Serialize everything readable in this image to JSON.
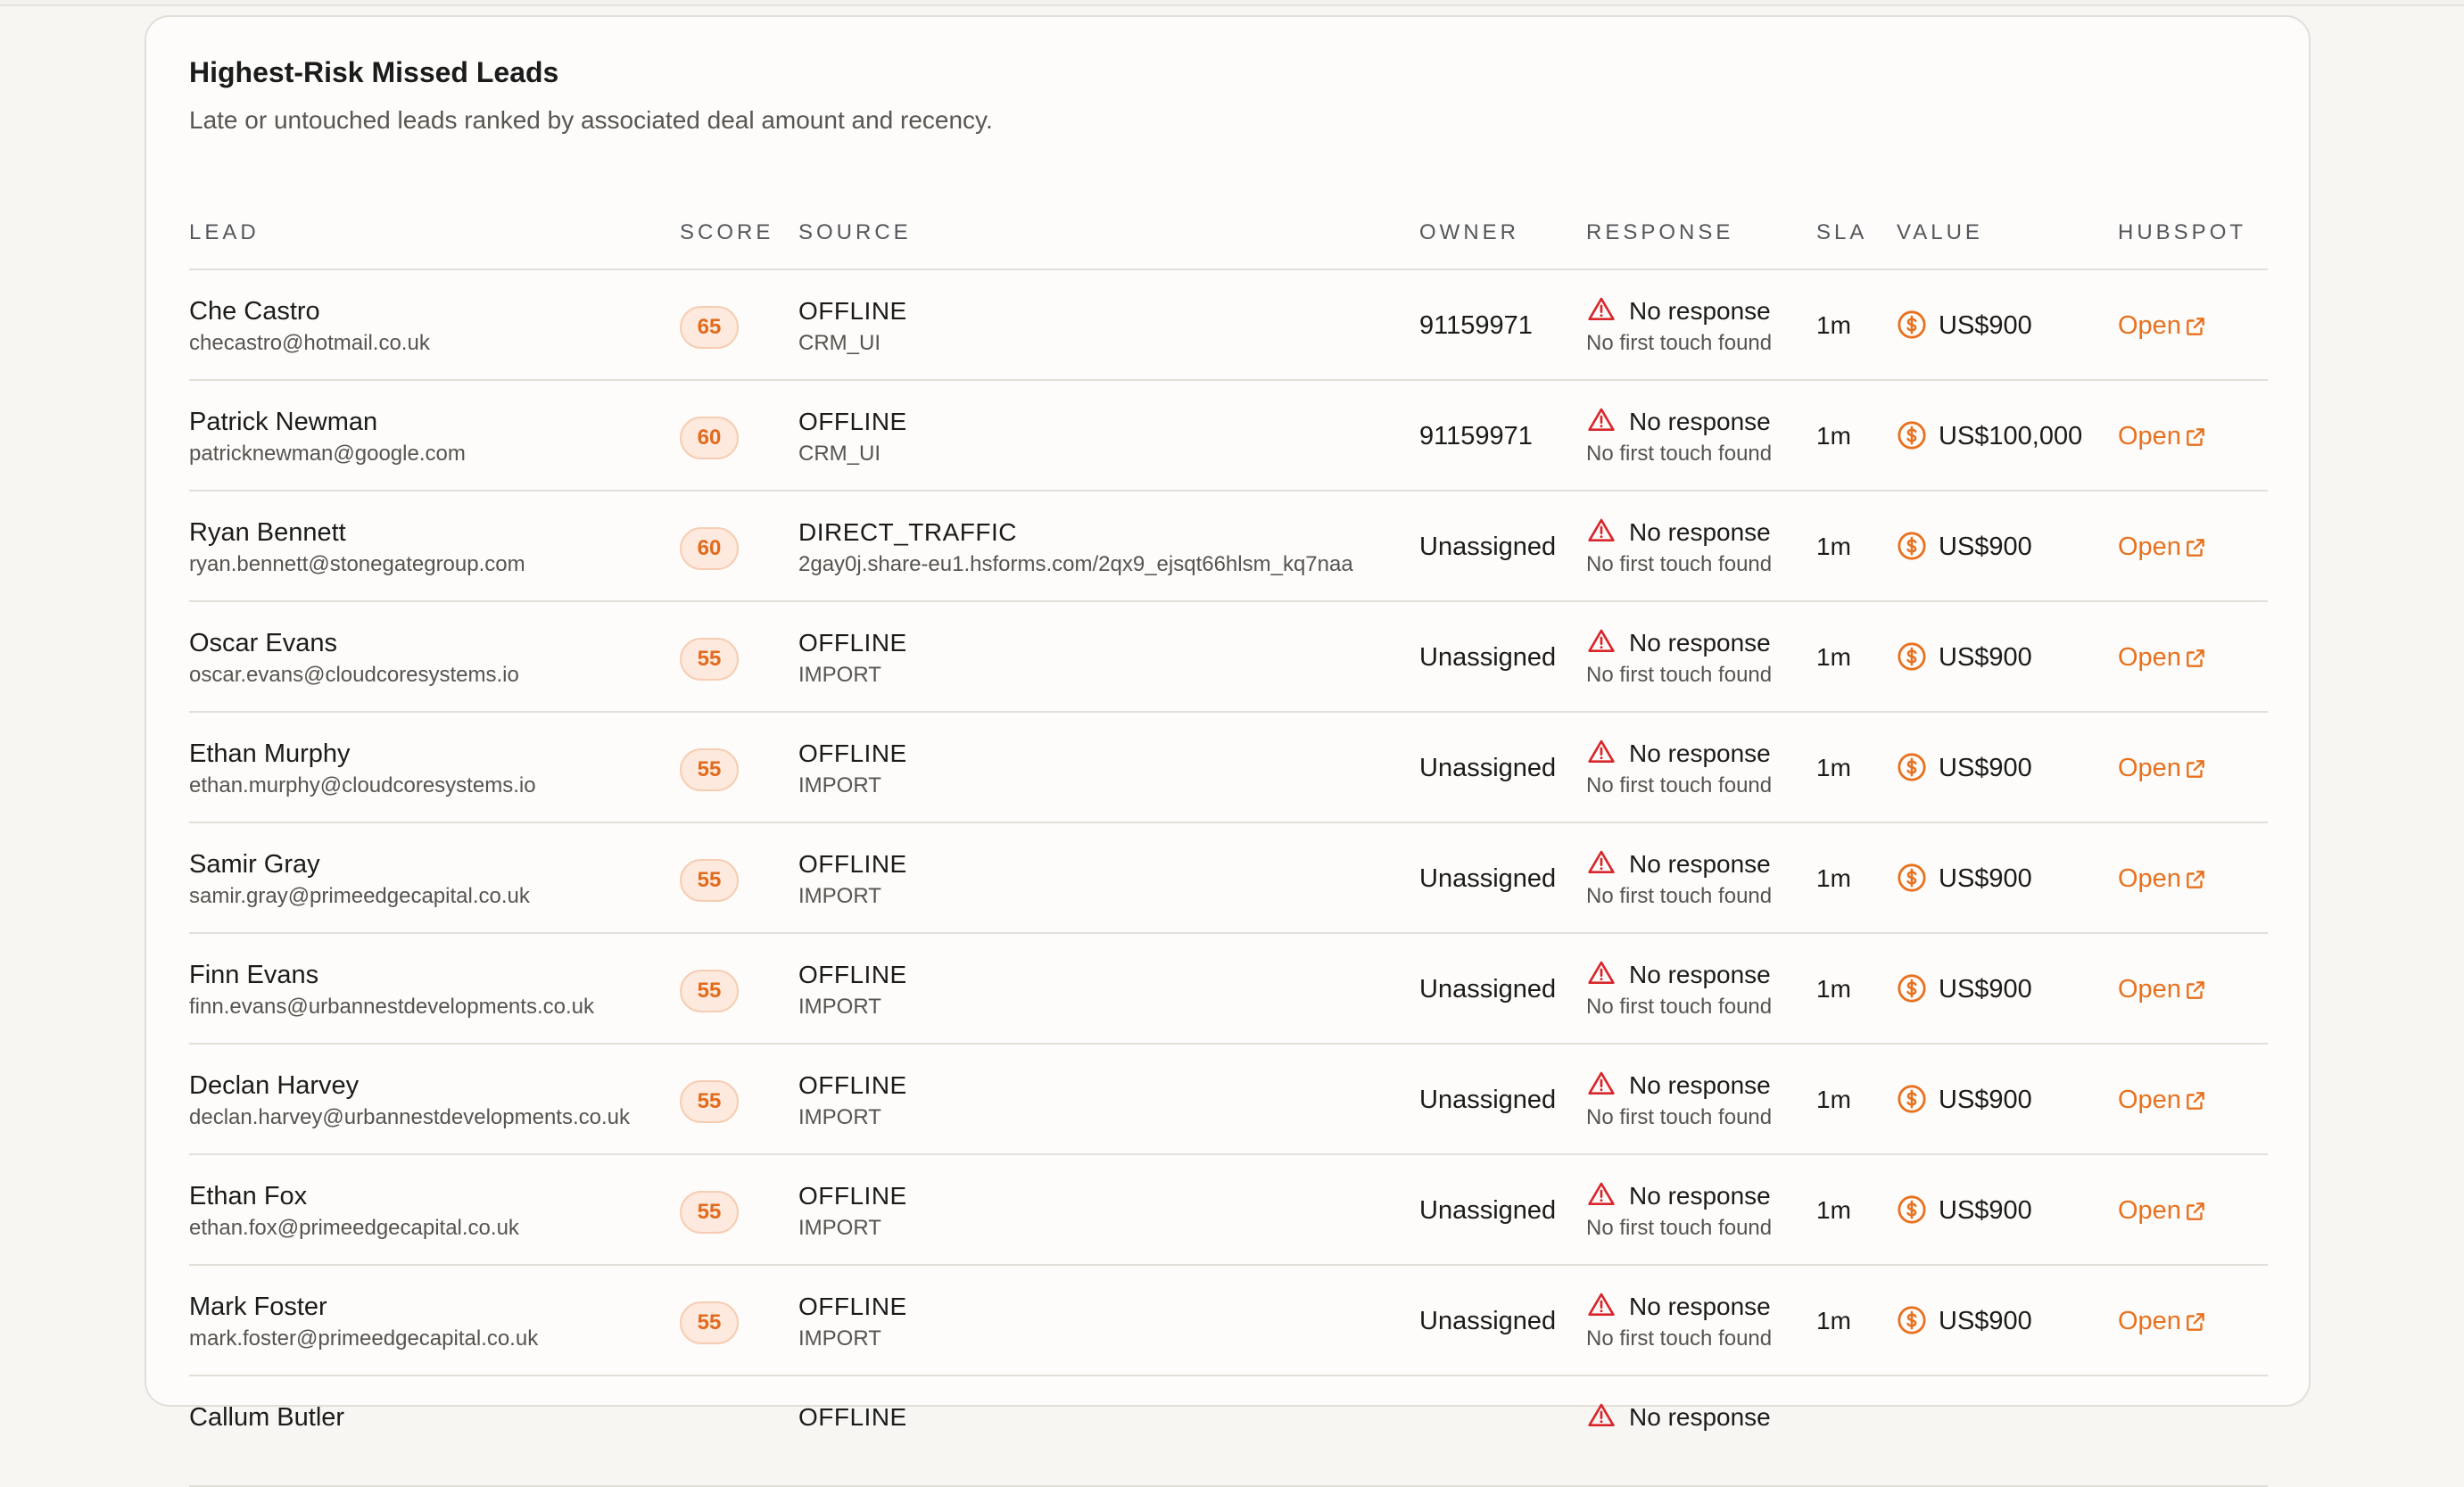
{
  "card": {
    "title": "Highest-Risk Missed Leads",
    "subtitle": "Late or untouched leads ranked by associated deal amount and recency."
  },
  "columns": {
    "lead": "LEAD",
    "score": "SCORE",
    "source": "SOURCE",
    "owner": "OWNER",
    "response": "RESPONSE",
    "sla": "SLA",
    "value": "VALUE",
    "hubspot": "HUBSPOT"
  },
  "colors": {
    "accent": "#e8711f",
    "warning": "#d8262b",
    "score_bg": "#fde9dd"
  },
  "icons": {
    "response": "warning-triangle-icon",
    "value": "dollar-coin-icon",
    "hubspot": "external-link-icon"
  },
  "rows": [
    {
      "name": "Che Castro",
      "email": "checastro@hotmail.co.uk",
      "score": "65",
      "source": "OFFLINE",
      "source_detail": "CRM_UI",
      "owner": "91159971",
      "response": "No response",
      "response_detail": "No first touch found",
      "sla": "1m",
      "value": "US$900",
      "link": "Open"
    },
    {
      "name": "Patrick Newman",
      "email": "patricknewman@google.com",
      "score": "60",
      "source": "OFFLINE",
      "source_detail": "CRM_UI",
      "owner": "91159971",
      "response": "No response",
      "response_detail": "No first touch found",
      "sla": "1m",
      "value": "US$100,000",
      "link": "Open"
    },
    {
      "name": "Ryan Bennett",
      "email": "ryan.bennett@stonegategroup.com",
      "score": "60",
      "source": "DIRECT_TRAFFIC",
      "source_detail": "2gay0j.share-eu1.hsforms.com/2qx9_ejsqt66hlsm_kq7naa",
      "owner": "Unassigned",
      "response": "No response",
      "response_detail": "No first touch found",
      "sla": "1m",
      "value": "US$900",
      "link": "Open"
    },
    {
      "name": "Oscar Evans",
      "email": "oscar.evans@cloudcoresystems.io",
      "score": "55",
      "source": "OFFLINE",
      "source_detail": "IMPORT",
      "owner": "Unassigned",
      "response": "No response",
      "response_detail": "No first touch found",
      "sla": "1m",
      "value": "US$900",
      "link": "Open"
    },
    {
      "name": "Ethan Murphy",
      "email": "ethan.murphy@cloudcoresystems.io",
      "score": "55",
      "source": "OFFLINE",
      "source_detail": "IMPORT",
      "owner": "Unassigned",
      "response": "No response",
      "response_detail": "No first touch found",
      "sla": "1m",
      "value": "US$900",
      "link": "Open"
    },
    {
      "name": "Samir Gray",
      "email": "samir.gray@primeedgecapital.co.uk",
      "score": "55",
      "source": "OFFLINE",
      "source_detail": "IMPORT",
      "owner": "Unassigned",
      "response": "No response",
      "response_detail": "No first touch found",
      "sla": "1m",
      "value": "US$900",
      "link": "Open"
    },
    {
      "name": "Finn Evans",
      "email": "finn.evans@urbannestdevelopments.co.uk",
      "score": "55",
      "source": "OFFLINE",
      "source_detail": "IMPORT",
      "owner": "Unassigned",
      "response": "No response",
      "response_detail": "No first touch found",
      "sla": "1m",
      "value": "US$900",
      "link": "Open"
    },
    {
      "name": "Declan Harvey",
      "email": "declan.harvey@urbannestdevelopments.co.uk",
      "score": "55",
      "source": "OFFLINE",
      "source_detail": "IMPORT",
      "owner": "Unassigned",
      "response": "No response",
      "response_detail": "No first touch found",
      "sla": "1m",
      "value": "US$900",
      "link": "Open"
    },
    {
      "name": "Ethan Fox",
      "email": "ethan.fox@primeedgecapital.co.uk",
      "score": "55",
      "source": "OFFLINE",
      "source_detail": "IMPORT",
      "owner": "Unassigned",
      "response": "No response",
      "response_detail": "No first touch found",
      "sla": "1m",
      "value": "US$900",
      "link": "Open"
    },
    {
      "name": "Mark Foster",
      "email": "mark.foster@primeedgecapital.co.uk",
      "score": "55",
      "source": "OFFLINE",
      "source_detail": "IMPORT",
      "owner": "Unassigned",
      "response": "No response",
      "response_detail": "No first touch found",
      "sla": "1m",
      "value": "US$900",
      "link": "Open"
    },
    {
      "name": "Callum Butler",
      "email": "",
      "score": "",
      "source": "OFFLINE",
      "source_detail": "",
      "owner": "",
      "response": "No response",
      "response_detail": "",
      "sla": "",
      "value": "",
      "link": ""
    }
  ]
}
